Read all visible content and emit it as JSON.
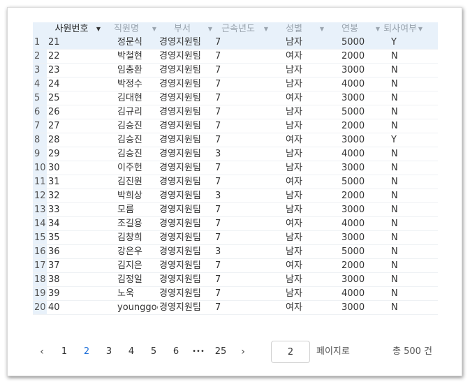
{
  "columns": [
    "사원번호",
    "직원명",
    "부서",
    "근속년도",
    "성별",
    "연봉",
    "퇴사여부"
  ],
  "rows": [
    {
      "no": "1",
      "id": "21",
      "name": "정문식",
      "dept": "경영지원팀",
      "years": "7",
      "gender": "남자",
      "salary": "5000",
      "retired": "Y"
    },
    {
      "no": "2",
      "id": "22",
      "name": "박철현",
      "dept": "경영지원팀",
      "years": "7",
      "gender": "여자",
      "salary": "2000",
      "retired": "N"
    },
    {
      "no": "3",
      "id": "23",
      "name": "임충환",
      "dept": "경영지원팀",
      "years": "7",
      "gender": "남자",
      "salary": "3000",
      "retired": "N"
    },
    {
      "no": "4",
      "id": "24",
      "name": "박정수",
      "dept": "경영지원팀",
      "years": "7",
      "gender": "남자",
      "salary": "4000",
      "retired": "N"
    },
    {
      "no": "5",
      "id": "25",
      "name": "김대현",
      "dept": "경영지원팀",
      "years": "7",
      "gender": "여자",
      "salary": "3000",
      "retired": "N"
    },
    {
      "no": "6",
      "id": "26",
      "name": "김규리",
      "dept": "경영지원팀",
      "years": "7",
      "gender": "남자",
      "salary": "5000",
      "retired": "N"
    },
    {
      "no": "7",
      "id": "27",
      "name": "김승진",
      "dept": "경영지원팀",
      "years": "7",
      "gender": "남자",
      "salary": "2000",
      "retired": "N"
    },
    {
      "no": "8",
      "id": "28",
      "name": "김승진",
      "dept": "경영지원팀",
      "years": "7",
      "gender": "여자",
      "salary": "3000",
      "retired": "Y"
    },
    {
      "no": "9",
      "id": "29",
      "name": "김승진",
      "dept": "경영지원팀",
      "years": "3",
      "gender": "남자",
      "salary": "4000",
      "retired": "N"
    },
    {
      "no": "10",
      "id": "30",
      "name": "이주헌",
      "dept": "경영지원팀",
      "years": "7",
      "gender": "남자",
      "salary": "3000",
      "retired": "N"
    },
    {
      "no": "11",
      "id": "31",
      "name": "김진원",
      "dept": "경영지원팀",
      "years": "7",
      "gender": "여자",
      "salary": "5000",
      "retired": "N"
    },
    {
      "no": "12",
      "id": "32",
      "name": "박희상",
      "dept": "경영지원팀",
      "years": "3",
      "gender": "남자",
      "salary": "2000",
      "retired": "N"
    },
    {
      "no": "13",
      "id": "33",
      "name": "모름",
      "dept": "경영지원팀",
      "years": "7",
      "gender": "남자",
      "salary": "3000",
      "retired": "N"
    },
    {
      "no": "14",
      "id": "34",
      "name": "조길용",
      "dept": "경영지원팀",
      "years": "7",
      "gender": "여자",
      "salary": "4000",
      "retired": "N"
    },
    {
      "no": "15",
      "id": "35",
      "name": "김창희",
      "dept": "경영지원팀",
      "years": "7",
      "gender": "남자",
      "salary": "3000",
      "retired": "N"
    },
    {
      "no": "16",
      "id": "36",
      "name": "강은우",
      "dept": "경영지원팀",
      "years": "3",
      "gender": "남자",
      "salary": "5000",
      "retired": "N"
    },
    {
      "no": "17",
      "id": "37",
      "name": "김지은",
      "dept": "경영지원팀",
      "years": "7",
      "gender": "여자",
      "salary": "2000",
      "retired": "N"
    },
    {
      "no": "18",
      "id": "38",
      "name": "김정일",
      "dept": "경영지원팀",
      "years": "7",
      "gender": "남자",
      "salary": "3000",
      "retired": "N"
    },
    {
      "no": "19",
      "id": "39",
      "name": "노욱",
      "dept": "경영지원팀",
      "years": "7",
      "gender": "남자",
      "salary": "4000",
      "retired": "N"
    },
    {
      "no": "20",
      "id": "40",
      "name": "younggoo",
      "dept": "경영지원팀",
      "years": "7",
      "gender": "여자",
      "salary": "3000",
      "retired": "N"
    }
  ],
  "pagination": {
    "prev_icon": "chevron-left-icon",
    "next_icon": "chevron-right-icon",
    "prev_glyph": "‹",
    "next_glyph": "›",
    "pages": [
      "1",
      "2",
      "3",
      "4",
      "5",
      "6"
    ],
    "current_page": "2",
    "ellipsis": "•••",
    "last_page": "25",
    "goto_value": "2",
    "goto_label": "페이지로",
    "total_label": "총 500 건"
  },
  "colors": {
    "header_bg": "#e8f1fa",
    "selected_row_bg": "#e8f1fa",
    "accent": "#1e6fd9"
  }
}
